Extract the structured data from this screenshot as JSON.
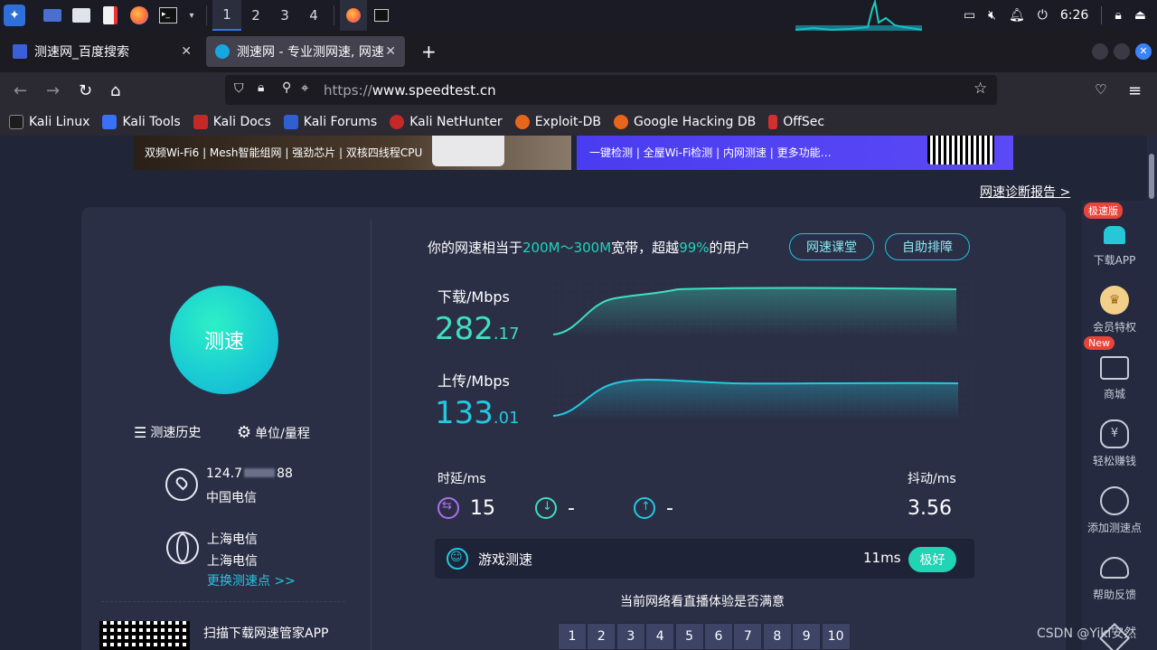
{
  "taskbar": {
    "workspaces": [
      "1",
      "2",
      "3",
      "4"
    ],
    "time": "6:26"
  },
  "tabs": [
    {
      "title": "测速网_百度搜索"
    },
    {
      "title": "测速网 - 专业测网速, 网速"
    }
  ],
  "url": {
    "scheme": "https://",
    "host": "www.speedtest.cn"
  },
  "bookmarks": [
    "Kali Linux",
    "Kali Tools",
    "Kali Docs",
    "Kali Forums",
    "Kali NetHunter",
    "Exploit-DB",
    "Google Hacking DB",
    "OffSec"
  ],
  "banners": {
    "left_text": "双频Wi-Fi6 | Mesh智能组网 | 强劲芯片 | 双核四线程CPU",
    "right_text": "一键检测  |  全屋Wi-Fi检测  |  内网测速  |  更多功能…"
  },
  "report_link": "网速诊断报告 >",
  "left": {
    "go_label": "测速",
    "history_label": "测速历史",
    "unit_label": "单位/量程",
    "ip": "124.7",
    "ip_tail": "88",
    "isp": "中国电信",
    "server_city": "上海电信",
    "server_name": "上海电信",
    "change_server": "更换测速点 >>",
    "qr_text": "扫描下载网速管家APP"
  },
  "summary": {
    "prefix": "你的网速相当于",
    "band": "200M～300M",
    "mid": "宽带，超越",
    "percent": "99%",
    "suffix": "的用户"
  },
  "buttons": {
    "course": "网速课堂",
    "self_check": "自助排障"
  },
  "download": {
    "label": "下载/Mbps",
    "int": "282",
    "dec": ".17"
  },
  "upload": {
    "label": "上传/Mbps",
    "int": "133",
    "dec": ".01"
  },
  "latency": {
    "label": "时延/ms",
    "value": "15",
    "down": "-",
    "up": "-"
  },
  "jitter": {
    "label": "抖动/ms",
    "value": "3.56"
  },
  "game": {
    "label": "游戏测速",
    "value": "11ms",
    "grade": "极好"
  },
  "live_question": "当前网络看直播体验是否满意",
  "ratings": [
    "1",
    "2",
    "3",
    "4",
    "5",
    "6",
    "7",
    "8",
    "9",
    "10"
  ],
  "sidebar": [
    {
      "label": "下载APP",
      "badge": "极速版"
    },
    {
      "label": "会员特权",
      "badge": ""
    },
    {
      "label": "商城",
      "badge": "New"
    },
    {
      "label": "轻松赚钱",
      "badge": ""
    },
    {
      "label": "添加测速点",
      "badge": ""
    },
    {
      "label": "帮助反馈",
      "badge": ""
    }
  ],
  "watermark": "CSDN @Yiki安然",
  "colors": {
    "accent_teal": "#22d3b4",
    "accent_cyan": "#16c8e0",
    "download": "#3ee0c0",
    "upload": "#22c9e0"
  }
}
